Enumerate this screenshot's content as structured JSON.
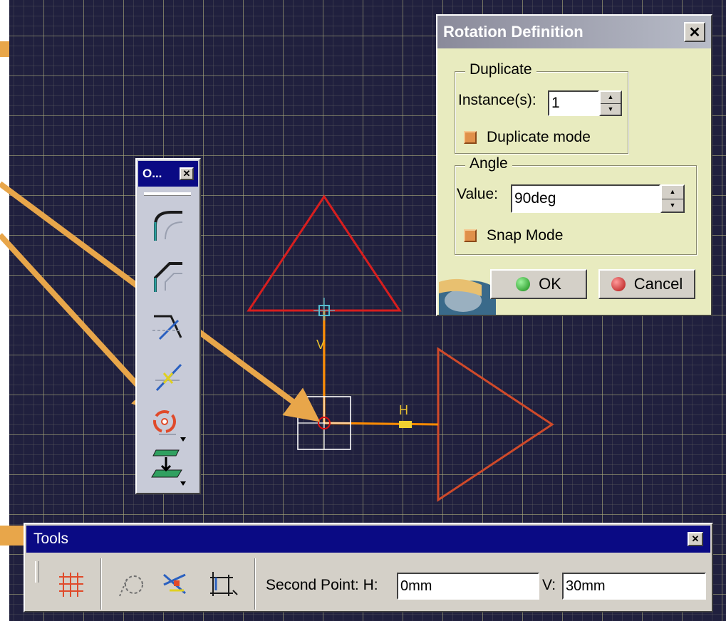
{
  "rotation_dialog": {
    "title": "Rotation Definition",
    "close": "✕",
    "duplicate": {
      "group_title": "Duplicate",
      "instances_label": "Instance(s):",
      "instances_value": "1",
      "duplicate_mode_label": "Duplicate mode",
      "duplicate_mode_checked": true
    },
    "angle": {
      "group_title": "Angle",
      "value_label": "Value:",
      "value": "90deg",
      "snap_mode_label": "Snap Mode",
      "snap_mode_checked": true
    },
    "ok_label": "OK",
    "cancel_label": "Cancel"
  },
  "operations_toolbar": {
    "title": "O...",
    "close": "✕",
    "tools": [
      "corner-icon",
      "chamfer-icon",
      "trim-icon",
      "quick-trim-icon",
      "rotate-icon",
      "project-3d-elements-icon"
    ]
  },
  "tools_bar": {
    "title": "Tools",
    "close": "✕",
    "second_point_label": "Second Point: H:",
    "h_value": "0mm",
    "v_label": "V:",
    "v_value": "30mm"
  },
  "sketch": {
    "v_axis_label": "V",
    "h_axis_label": "H"
  },
  "colors": {
    "background": "#20203e",
    "title_bar": "#0a0a84",
    "dialog_bg": "#e8ebbf",
    "original_triangle": "#d81e1e",
    "rotated_triangle": "#d04a2a",
    "arrow": "#e8a64a",
    "axis": "#ff8a00"
  }
}
